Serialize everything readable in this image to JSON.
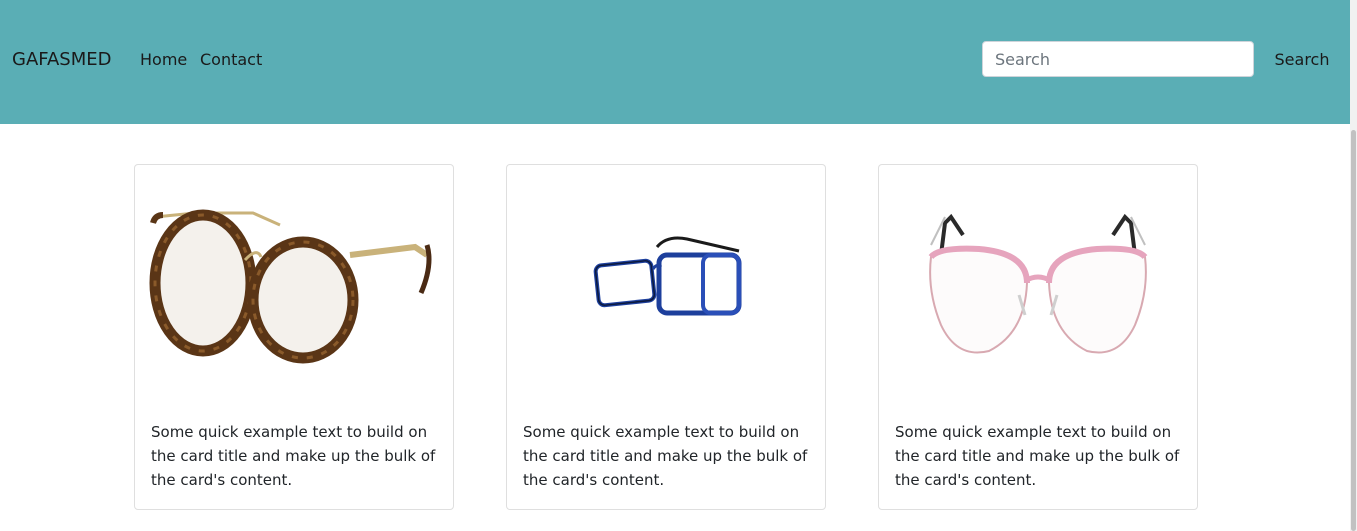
{
  "navbar": {
    "brand": "GAFASMED",
    "links": [
      {
        "label": "Home"
      },
      {
        "label": "Contact"
      }
    ],
    "search": {
      "placeholder": "Search",
      "value": "",
      "button_label": "Search"
    },
    "background_color": "#5aaeb5"
  },
  "cards": [
    {
      "image": "tortoiseshell-round-glasses",
      "text": "Some quick example text to build on the card title and make up the bulk of the card's content."
    },
    {
      "image": "blue-rectangular-glasses",
      "text": "Some quick example text to build on the card title and make up the bulk of the card's content."
    },
    {
      "image": "pink-cat-eye-glasses",
      "text": "Some quick example text to build on the card title and make up the bulk of the card's content."
    }
  ]
}
